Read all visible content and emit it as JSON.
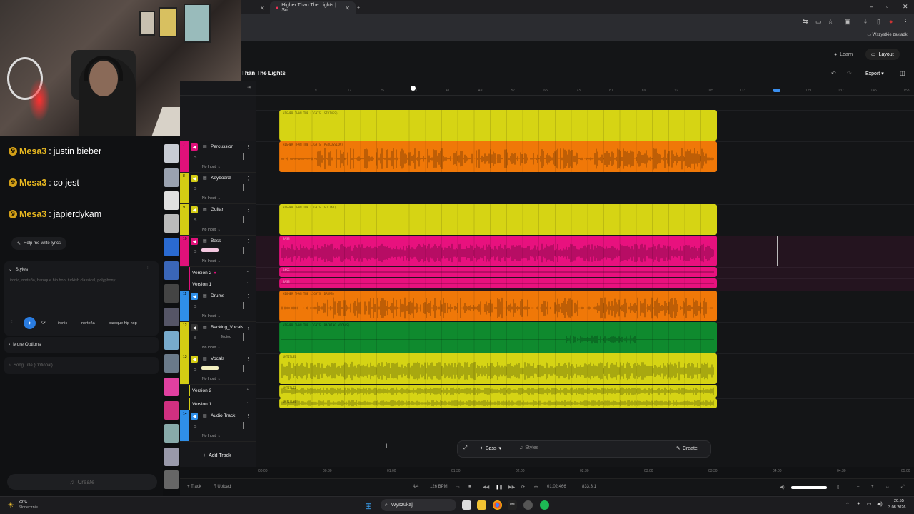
{
  "browser": {
    "tab_title": "Higher Than The Lights | Su",
    "bookmarks_folder": "Wszystkie zakładki"
  },
  "app": {
    "learn": "Learn",
    "layout": "Layout",
    "song_title": "Than The Lights",
    "export": "Export"
  },
  "chat": [
    {
      "name": "Mesa3",
      "msg": "justin bieber"
    },
    {
      "name": "Mesa3",
      "msg": "co jest"
    },
    {
      "name": "Mesa3",
      "msg": "japierdykam"
    }
  ],
  "left": {
    "help_lyrics": "Help me write lyrics",
    "styles_label": "Styles",
    "styles_text": "ironic, norteña, baroque hip hop, turkish classical, polyphony",
    "chips": [
      "ironic",
      "norteña",
      "baroque hip hop"
    ],
    "more_options": "More Options",
    "song_title_placeholder": "Song Title (Optional)",
    "create": "Create"
  },
  "tracks": [
    {
      "num": "7",
      "name": "Percussion",
      "input": "No Input",
      "color": "#e0117a"
    },
    {
      "num": "8",
      "name": "Keyboard",
      "input": "No Input",
      "color": "#d4cc14"
    },
    {
      "num": "9",
      "name": "Guitar",
      "input": "No Input",
      "color": "#d4cc14"
    },
    {
      "num": "10",
      "name": "Bass",
      "input": "No Input",
      "color": "#e0117a"
    },
    {
      "num": "11",
      "name": "Drums",
      "input": "No Input",
      "color": "#2f8fe8"
    },
    {
      "num": "12",
      "name": "Backing_Vocals",
      "input": "No Input",
      "color": "#d4cc14",
      "status": "Muted"
    },
    {
      "num": "13",
      "name": "Vocals",
      "input": "No Input",
      "color": "#d4cc14"
    },
    {
      "num": "14",
      "name": "Audio Track",
      "input": "No Input",
      "color": "#2f8fe8"
    }
  ],
  "versions": {
    "v2": "Version 2",
    "v1": "Version 1"
  },
  "add_track": "Add Track",
  "footer": {
    "track": "Track",
    "upload": "Upload"
  },
  "ruler_ticks": [
    "1",
    "9",
    "17",
    "25",
    "33",
    "41",
    "49",
    "57",
    "65",
    "73",
    "81",
    "89",
    "97",
    "105",
    "113",
    "121",
    "129",
    "137",
    "145",
    "153"
  ],
  "clips": [
    {
      "label": "HIGHER THAN THE LIGHTS (STRINGS)",
      "color": "#d6d414"
    },
    {
      "label": "HIGHER THAN THE LIGHTS (PERCUSSION)",
      "color": "#f07808"
    },
    {
      "label": "HIGHER THAN THE LIGHTS (GUITAR)",
      "color": "#d6d414"
    },
    {
      "label": "BASS",
      "color": "#e8117e"
    },
    {
      "label": "BASS",
      "color": "#e8117e"
    },
    {
      "label": "BASS",
      "color": "#e8117e"
    },
    {
      "label": "HIGHER THAN THE LIGHTS (DRUMS)",
      "color": "#f07808"
    },
    {
      "label": "HIGHER THAN THE LIGHTS (BACKING VOCALS)",
      "color": "#0f8a2e"
    },
    {
      "label": "UNTITLED",
      "color": "#d6d414"
    },
    {
      "label": "UNTITLED",
      "color": "#d6d414"
    },
    {
      "label": "UNTITLED",
      "color": "#d6d414"
    }
  ],
  "floatbar": {
    "track": "Bass",
    "styles": "Styles",
    "create": "Create"
  },
  "time_ticks": [
    "00:00",
    "00:30",
    "01:00",
    "01:30",
    "02:00",
    "02:30",
    "03:00",
    "03:30",
    "04:00",
    "04:30",
    "05:00"
  ],
  "transport": {
    "sig": "4/4",
    "bpm": "126 BPM",
    "time": "01:02.466",
    "bars": "833.3.1"
  },
  "taskbar": {
    "weather_temp": "28°C",
    "weather_desc": "Słonecznie",
    "search": "Wyszukaj",
    "time": "20:55",
    "date": "3.08.2026"
  }
}
